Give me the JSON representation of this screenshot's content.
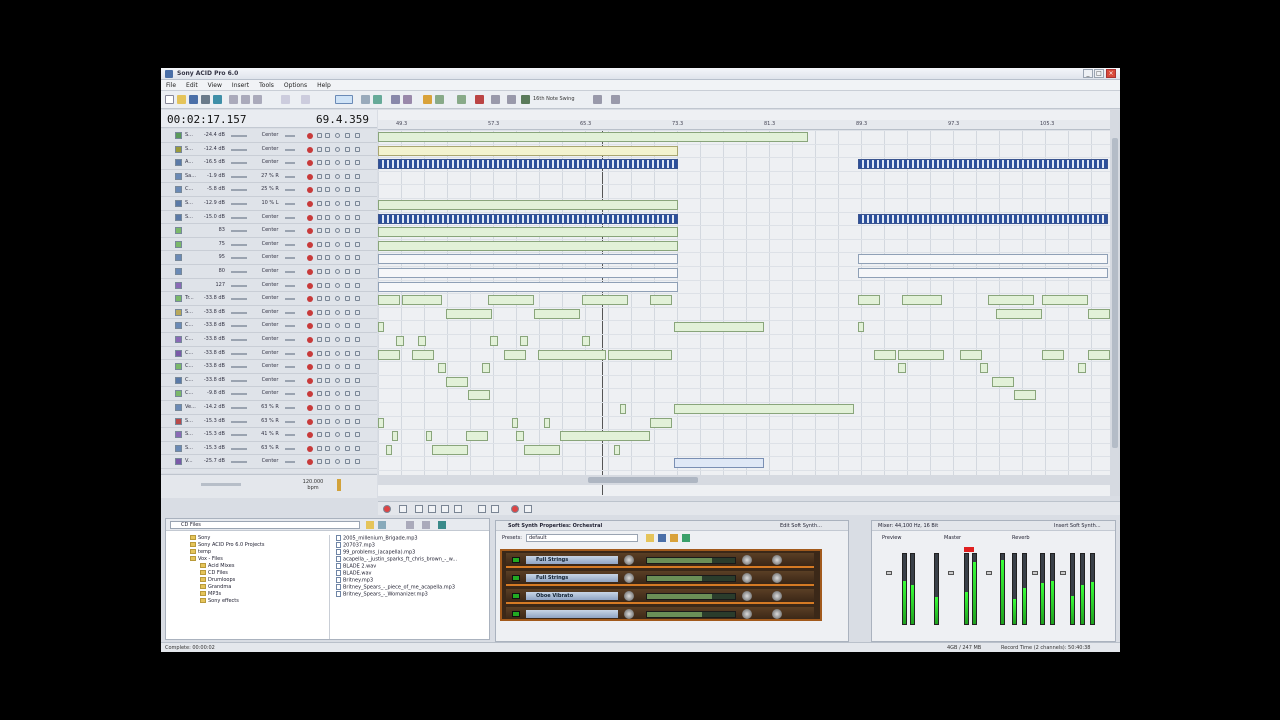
{
  "window": {
    "title": "Sony ACID Pro 6.0"
  },
  "menu": [
    "File",
    "Edit",
    "View",
    "Insert",
    "Tools",
    "Options",
    "Help"
  ],
  "toolbar": {
    "snap_label": "16th Note Swing"
  },
  "time": {
    "position": "00:02:17.157",
    "measure": "69.4.359"
  },
  "tracks": [
    {
      "name": "S...",
      "db": "-24.4 dB",
      "pan": "Center",
      "color": "#5a9a5a"
    },
    {
      "name": "S...",
      "db": "-12.4 dB",
      "pan": "Center",
      "color": "#9a9a3a"
    },
    {
      "name": "A...",
      "db": "-16.5 dB",
      "pan": "Center",
      "color": "#5a7aa8"
    },
    {
      "name": "Sa...",
      "db": "-1.9 dB",
      "pan": "27 % R",
      "color": "#6a8ab6"
    },
    {
      "name": "C...",
      "db": "-5.8 dB",
      "pan": "25 % R",
      "color": "#6a8ab6"
    },
    {
      "name": "S...",
      "db": "-12.9 dB",
      "pan": "10 % L",
      "color": "#5a7aa8"
    },
    {
      "name": "S...",
      "db": "-15.0 dB",
      "pan": "Center",
      "color": "#5a7aa8"
    },
    {
      "name": "",
      "db": "83",
      "pan": "Center",
      "color": "#7ab86a"
    },
    {
      "name": "",
      "db": "75",
      "pan": "Center",
      "color": "#7ab86a"
    },
    {
      "name": "",
      "db": "95",
      "pan": "Center",
      "color": "#6a8ab6"
    },
    {
      "name": "",
      "db": "80",
      "pan": "Center",
      "color": "#6a8ab6"
    },
    {
      "name": "",
      "db": "127",
      "pan": "Center",
      "color": "#8a6ab6"
    },
    {
      "name": "Tr...",
      "db": "-33.8 dB",
      "pan": "Center",
      "color": "#7ab86a"
    },
    {
      "name": "S...",
      "db": "-33.8 dB",
      "pan": "Center",
      "color": "#b8a85a"
    },
    {
      "name": "C...",
      "db": "-33.8 dB",
      "pan": "Center",
      "color": "#6a8ab6"
    },
    {
      "name": "C...",
      "db": "-33.8 dB",
      "pan": "Center",
      "color": "#8a6ab6"
    },
    {
      "name": "C...",
      "db": "-33.8 dB",
      "pan": "Center",
      "color": "#7a5aa8"
    },
    {
      "name": "C...",
      "db": "-33.8 dB",
      "pan": "Center",
      "color": "#7ab86a"
    },
    {
      "name": "C...",
      "db": "-33.8 dB",
      "pan": "Center",
      "color": "#5a7aa8"
    },
    {
      "name": "C...",
      "db": "-9.8 dB",
      "pan": "Center",
      "color": "#7ab86a"
    },
    {
      "name": "Ve...",
      "db": "-14.2 dB",
      "pan": "63 % R",
      "color": "#6a8ab6"
    },
    {
      "name": "S...",
      "db": "-15.3 dB",
      "pan": "63 % R",
      "color": "#b84a4a"
    },
    {
      "name": "S...",
      "db": "-15.3 dB",
      "pan": "41 % R",
      "color": "#8a6ab6"
    },
    {
      "name": "S...",
      "db": "-15.3 dB",
      "pan": "63 % R",
      "color": "#6a8ab6"
    },
    {
      "name": "V...",
      "db": "-25.7 dB",
      "pan": "Center",
      "color": "#7a5aa8"
    }
  ],
  "tempo": {
    "bpm": "120.000 bpm"
  },
  "ruler": [
    "49.3",
    "57.3",
    "65.3",
    "73.3",
    "81.3",
    "89.3",
    "97.3",
    "105.3"
  ],
  "explorer": {
    "path": "CD Files",
    "folders": [
      "Sony",
      "Sony ACID Pro 6.0 Projects",
      "temp",
      "Vox - Files",
      "Acid Mixes",
      "CD Files",
      "Drumloops",
      "Grandma",
      "MP3s",
      "Sony effects"
    ],
    "files": [
      "2005_millenium_Brigade.mp3",
      "207037.mp3",
      "99_problems_(acapella).mp3",
      "acapella_-_justin_sparks_ft_chris_brown_-_w...",
      "BLADE 2.wav",
      "BLADE.wav",
      "Britney.mp3",
      "Britney_Spears_-_piece_of_me_acapella.mp3",
      "Britney_Spears_-_Womanizer.mp3"
    ]
  },
  "synth": {
    "title": "Soft Synth Properties: Orchestral",
    "preset_label": "Presets:",
    "preset_value": "default",
    "edit_label": "Edit Soft Synth...",
    "slots": [
      "Full Strings",
      "Full Strings",
      "Oboe Vibrato",
      ""
    ]
  },
  "mixer": {
    "title": "Mixer: 44,100 Hz, 16 Bit",
    "insert_label": "Insert Soft Synth...",
    "preview": "Preview",
    "master": "Master",
    "reverb": "Reverb",
    "levels": [
      0.62,
      0.55,
      0.38,
      0.45,
      0.88,
      0.92,
      0.36,
      0.52,
      0.58,
      0.62,
      0.4,
      0.55,
      0.6
    ]
  },
  "status": {
    "left": "Complete: 00:00:02",
    "mem": "4GB / 247 MB",
    "right": "Record Time (2 channels): 50:40:38"
  }
}
